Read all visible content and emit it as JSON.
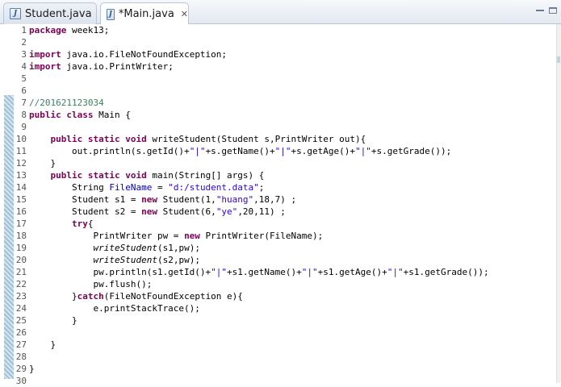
{
  "tabs": [
    {
      "label": "Student.java",
      "active": false
    },
    {
      "label": "*Main.java",
      "active": true
    }
  ],
  "colors": {
    "keyword": "#7f0055",
    "string": "#2a00ff",
    "comment": "#3f7f5f",
    "field": "#0000c0"
  },
  "lines": [
    {
      "n": "1",
      "t": [
        [
          "kw",
          "package"
        ],
        [
          "p",
          " week13;"
        ]
      ]
    },
    {
      "n": "2",
      "t": []
    },
    {
      "n": "3",
      "t": [
        [
          "kw",
          "import"
        ],
        [
          "p",
          " java.io.FileNotFoundException;"
        ]
      ]
    },
    {
      "n": "4",
      "t": [
        [
          "kw",
          "import"
        ],
        [
          "p",
          " java.io.PrintWriter;"
        ]
      ]
    },
    {
      "n": "5",
      "t": []
    },
    {
      "n": "6",
      "t": []
    },
    {
      "n": "7",
      "t": [
        [
          "cmt",
          "//201621123034"
        ]
      ]
    },
    {
      "n": "8",
      "t": [
        [
          "kw",
          "public class"
        ],
        [
          "p",
          " Main {"
        ]
      ]
    },
    {
      "n": "9",
      "t": []
    },
    {
      "n": "10",
      "t": [
        [
          "p",
          "    "
        ],
        [
          "kw",
          "public static void"
        ],
        [
          "p",
          " writeStudent(Student s,PrintWriter out){"
        ]
      ]
    },
    {
      "n": "11",
      "t": [
        [
          "p",
          "        out.println(s.getId()+"
        ],
        [
          "str",
          "\"|\""
        ],
        [
          "p",
          "+s.getName()+"
        ],
        [
          "str",
          "\"|\""
        ],
        [
          "p",
          "+s.getAge()+"
        ],
        [
          "str",
          "\"|\""
        ],
        [
          "p",
          "+s.getGrade());"
        ]
      ]
    },
    {
      "n": "12",
      "t": [
        [
          "p",
          "    }"
        ]
      ]
    },
    {
      "n": "13",
      "t": [
        [
          "p",
          "    "
        ],
        [
          "kw",
          "public static void"
        ],
        [
          "p",
          " main(String[] args) {"
        ]
      ]
    },
    {
      "n": "14",
      "t": [
        [
          "p",
          "        String "
        ],
        [
          "fld",
          "FileName"
        ],
        [
          "p",
          " = "
        ],
        [
          "str",
          "\"d:/student.data\""
        ],
        [
          "p",
          ";"
        ]
      ]
    },
    {
      "n": "15",
      "t": [
        [
          "p",
          "        Student s1 = "
        ],
        [
          "kw",
          "new"
        ],
        [
          "p",
          " Student(1,"
        ],
        [
          "str",
          "\"huang\""
        ],
        [
          "p",
          ",18,7) ;"
        ]
      ]
    },
    {
      "n": "16",
      "t": [
        [
          "p",
          "        Student s2 = "
        ],
        [
          "kw",
          "new"
        ],
        [
          "p",
          " Student(6,"
        ],
        [
          "str",
          "\"ye\""
        ],
        [
          "p",
          ",20,11) ;"
        ]
      ]
    },
    {
      "n": "17",
      "t": [
        [
          "p",
          "        "
        ],
        [
          "kw",
          "try"
        ],
        [
          "p",
          "{"
        ]
      ]
    },
    {
      "n": "18",
      "t": [
        [
          "p",
          "            PrintWriter pw = "
        ],
        [
          "kw",
          "new"
        ],
        [
          "p",
          " PrintWriter(FileName);"
        ]
      ]
    },
    {
      "n": "19",
      "t": [
        [
          "p",
          "            "
        ],
        [
          "stc",
          "writeStudent"
        ],
        [
          "p",
          "(s1,pw);"
        ]
      ]
    },
    {
      "n": "20",
      "t": [
        [
          "p",
          "            "
        ],
        [
          "stc",
          "writeStudent"
        ],
        [
          "p",
          "(s2,pw);"
        ]
      ]
    },
    {
      "n": "21",
      "t": [
        [
          "p",
          "            pw.println(s1.getId()+"
        ],
        [
          "str",
          "\"|\""
        ],
        [
          "p",
          "+s1.getName()+"
        ],
        [
          "str",
          "\"|\""
        ],
        [
          "p",
          "+s1.getAge()+"
        ],
        [
          "str",
          "\"|\""
        ],
        [
          "p",
          "+s1.getGrade());"
        ]
      ]
    },
    {
      "n": "22",
      "t": [
        [
          "p",
          "            pw.flush();"
        ]
      ]
    },
    {
      "n": "23",
      "t": [
        [
          "p",
          "        }"
        ],
        [
          "kw",
          "catch"
        ],
        [
          "p",
          "(FileNotFoundException e){"
        ]
      ]
    },
    {
      "n": "24",
      "t": [
        [
          "p",
          "            e.printStackTrace();"
        ]
      ]
    },
    {
      "n": "25",
      "t": [
        [
          "p",
          "        }"
        ]
      ]
    },
    {
      "n": "26",
      "t": []
    },
    {
      "n": "27",
      "t": [
        [
          "p",
          "    }"
        ]
      ]
    },
    {
      "n": "28",
      "t": []
    },
    {
      "n": "29",
      "t": [
        [
          "p",
          "}"
        ]
      ]
    },
    {
      "n": "30",
      "t": []
    }
  ]
}
